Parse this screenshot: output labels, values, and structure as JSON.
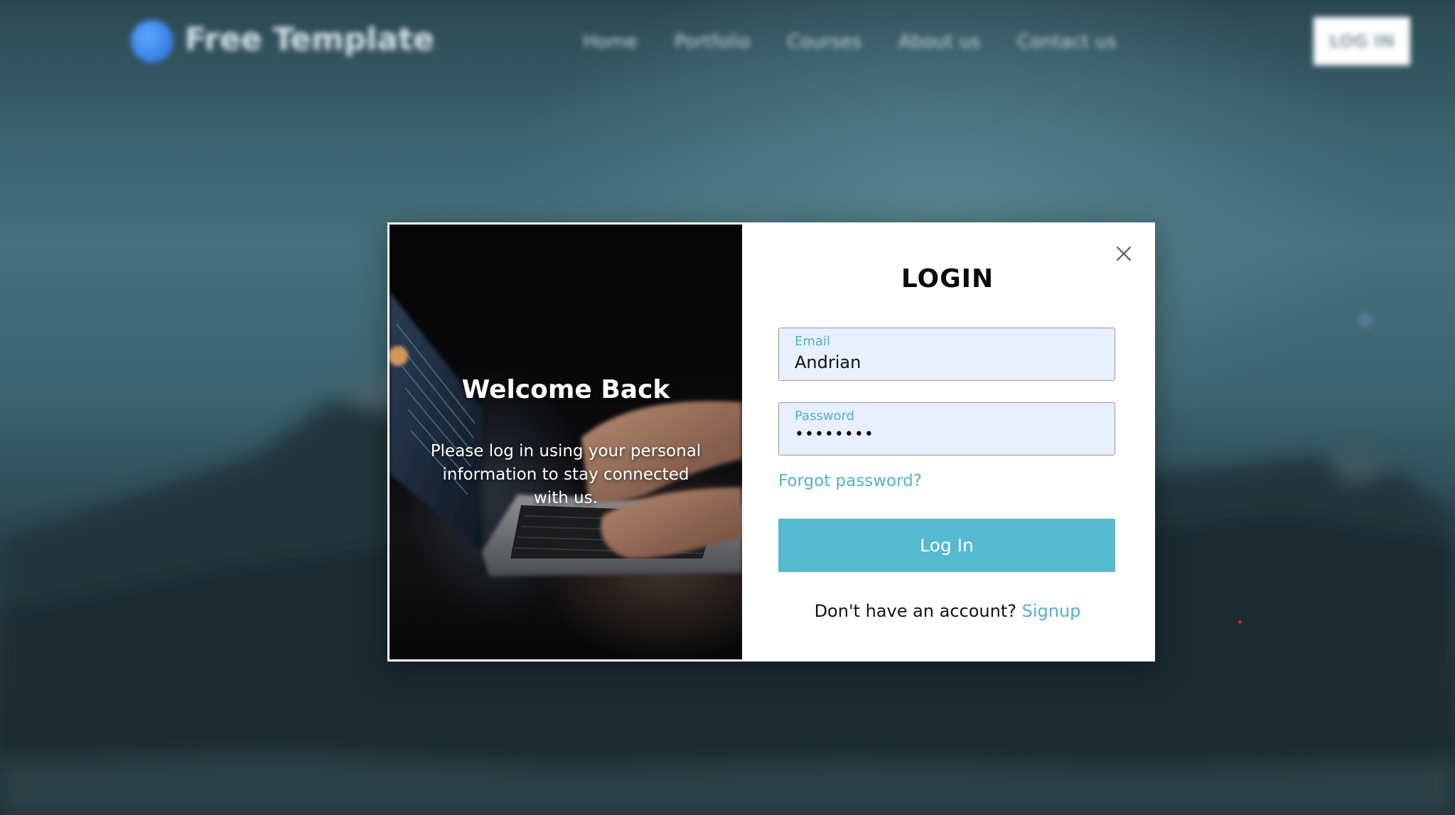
{
  "background_page": {
    "brand": "Free Template",
    "nav": [
      "Home",
      "Portfolio",
      "Courses",
      "About us",
      "Contact us"
    ],
    "login_button": "LOG IN"
  },
  "modal": {
    "left": {
      "title": "Welcome Back",
      "subtitle": "Please log in using your personal information to stay connected with us."
    },
    "right": {
      "title": "LOGIN",
      "email": {
        "label": "Email",
        "value": "Andrian"
      },
      "password": {
        "label": "Password",
        "value": "••••••••"
      },
      "forgot_link": "Forgot password?",
      "submit_label": "Log In",
      "signup_prompt": "Don't have an account?",
      "signup_link": "Signup"
    },
    "close_icon": "close-icon"
  },
  "colors": {
    "accent": "#55b9cf",
    "link": "#4fb3c9",
    "input_bg": "#e8effd"
  }
}
